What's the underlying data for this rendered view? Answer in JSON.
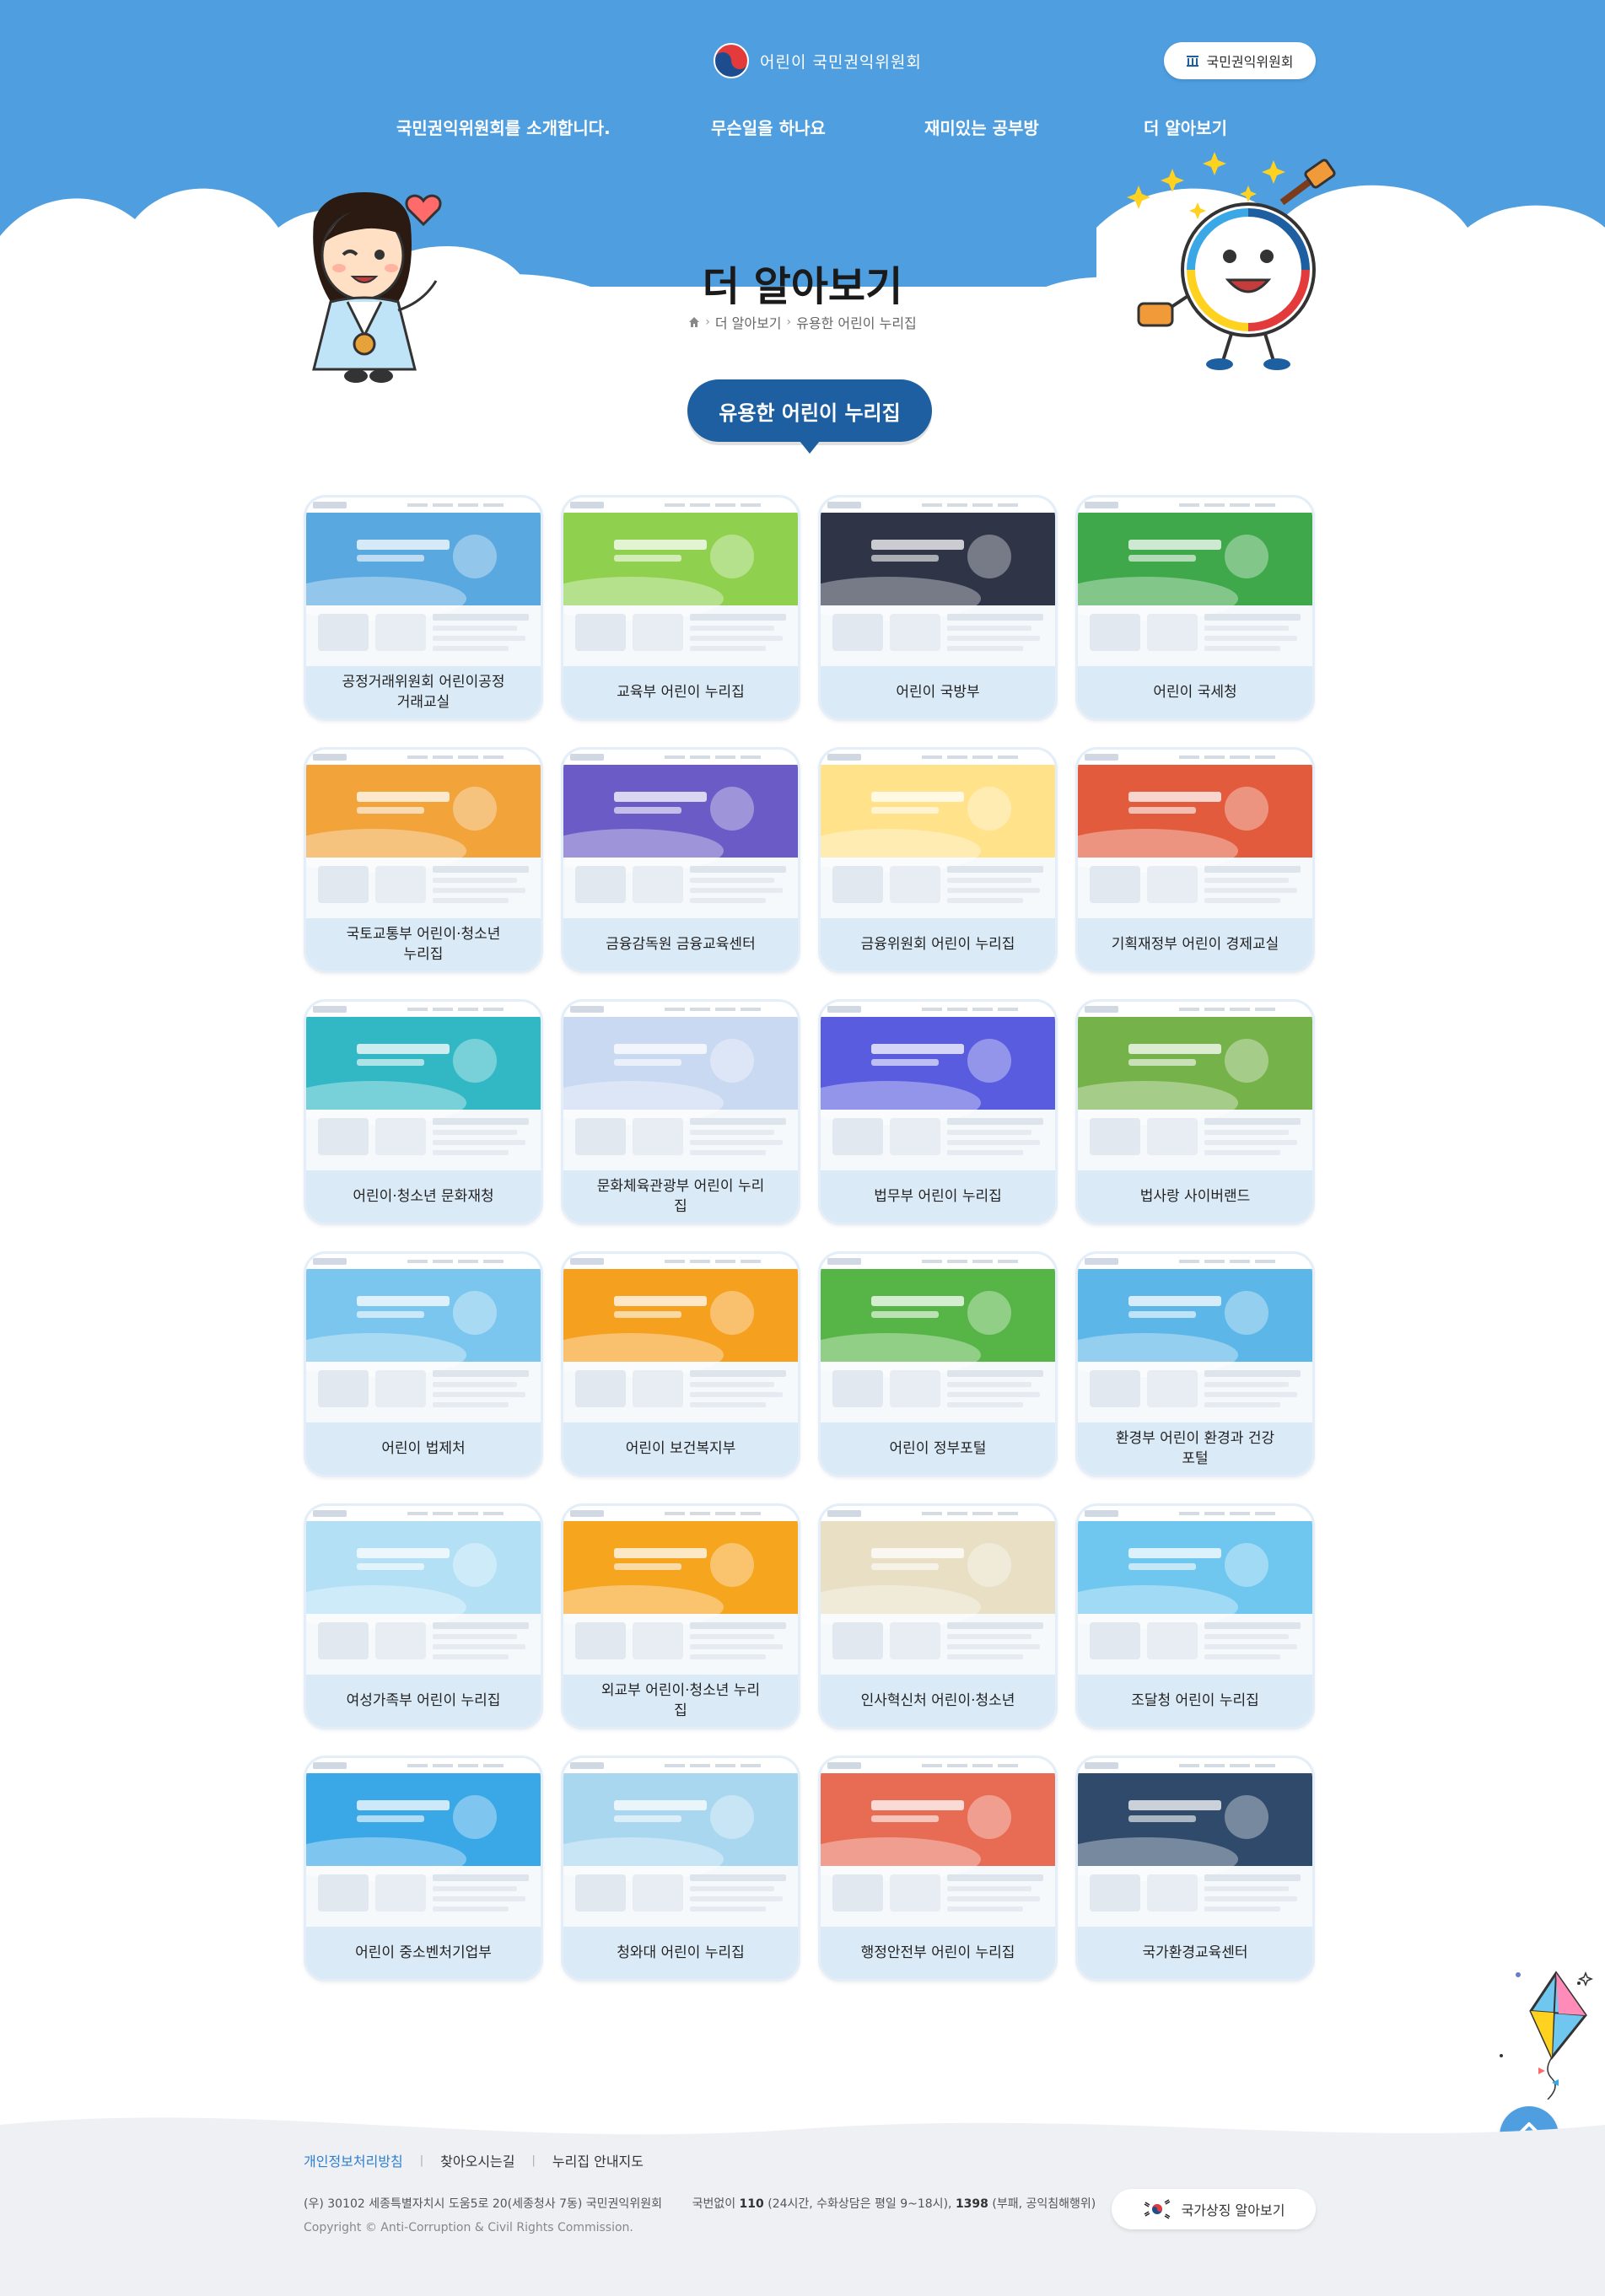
{
  "header": {
    "logo_text": "어린이 국민권익위원회",
    "acrc_button": "국민권익위원회",
    "nav": [
      "국민권익위원회를 소개합니다.",
      "무슨일을 하나요",
      "재미있는 공부방",
      "더 알아보기"
    ]
  },
  "page": {
    "title": "더 알아보기",
    "breadcrumb": [
      "더 알아보기",
      "유용한 어린이 누리집"
    ],
    "section": "유용한 어린이 누리집"
  },
  "sites": [
    {
      "label": "공정거래위원회 어린이공정거래교실",
      "theme": "#5aa8e0"
    },
    {
      "label": "교육부 어린이 누리집",
      "theme": "#8fd14f"
    },
    {
      "label": "어린이 국방부",
      "theme": "#2f3447"
    },
    {
      "label": "어린이 국세청",
      "theme": "#3fa84a"
    },
    {
      "label": "국토교통부 어린이·청소년 누리집",
      "theme": "#f2a33a"
    },
    {
      "label": "금융감독원 금융교육센터",
      "theme": "#6a5bc6"
    },
    {
      "label": "금융위원회 어린이 누리집",
      "theme": "#ffe28a"
    },
    {
      "label": "기획재정부 어린이 경제교실",
      "theme": "#e25b3c"
    },
    {
      "label": "어린이·청소년 문화재청",
      "theme": "#31b8c4"
    },
    {
      "label": "문화체육관광부 어린이 누리집",
      "theme": "#c9d9f2"
    },
    {
      "label": "법무부 어린이 누리집",
      "theme": "#5a5ce0"
    },
    {
      "label": "법사랑 사이버랜드",
      "theme": "#76b24a"
    },
    {
      "label": "어린이 법제처",
      "theme": "#7bc6ef"
    },
    {
      "label": "어린이 보건복지부",
      "theme": "#f6a020"
    },
    {
      "label": "어린이 정부포털",
      "theme": "#56b546"
    },
    {
      "label": "환경부 어린이 환경과 건강 포털",
      "theme": "#5db6e8"
    },
    {
      "label": "여성가족부 어린이 누리집",
      "theme": "#b3e0f5"
    },
    {
      "label": "외교부 어린이·청소년 누리집",
      "theme": "#f6a51f"
    },
    {
      "label": "인사혁신처 어린이·청소년",
      "theme": "#e8dfc4"
    },
    {
      "label": "조달청 어린이 누리집",
      "theme": "#6fc6ef"
    },
    {
      "label": "어린이 중소벤처기업부",
      "theme": "#3aa7e6"
    },
    {
      "label": "청와대 어린이 누리집",
      "theme": "#a9d7f0"
    },
    {
      "label": "행정안전부 어린이 누리집",
      "theme": "#e86b54"
    },
    {
      "label": "국가환경교육센터",
      "theme": "#2f4a6a"
    }
  ],
  "footer": {
    "links": [
      "개인정보처리방침",
      "찾아오시는길",
      "누리집 안내지도"
    ],
    "address": "(우) 30102 세종특별자치시 도움5로 20(세종청사 7동) 국민권익위원회",
    "phone_prefix": "국번없이",
    "phone_1": "110",
    "phone_mid": "(24시간, 수화상담은 평일 9~18시),",
    "phone_2": "1398",
    "phone_suffix": "(부패, 공익침해행위)",
    "copyright": "Copyright © Anti-Corruption & Civil Rights Commission.",
    "national_button": "국가상징 알아보기",
    "top_button": "위로"
  }
}
